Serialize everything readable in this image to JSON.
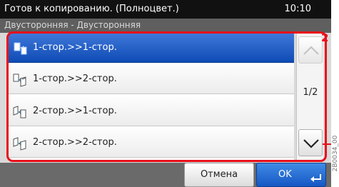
{
  "status": {
    "text": "Готов к копированию. (Полноцвет.)",
    "time": "10:10"
  },
  "subtitle": "Двусторонняя - Двусторонняя",
  "options": [
    {
      "label": "1-стор.>>1-стор.",
      "selected": true
    },
    {
      "label": "1-стор.>>2-стор.",
      "selected": false
    },
    {
      "label": "2-стор.>>1-стор.",
      "selected": false
    },
    {
      "label": "2-стор.>>2-стор.",
      "selected": false
    }
  ],
  "pager": {
    "indicator": "1/2",
    "up_icon": "chevron-up-icon",
    "down_icon": "chevron-down-icon"
  },
  "buttons": {
    "cancel": "Отмена",
    "ok": "OK",
    "ok_icon": "enter-icon"
  },
  "annotation": {
    "number": "2",
    "color": "#e8101b"
  },
  "side_code": "2B0034_00",
  "colors": {
    "selected_row": "#1f5fcc",
    "status_bar": "#111111",
    "subtitle_bar": "#5f5f5f"
  }
}
